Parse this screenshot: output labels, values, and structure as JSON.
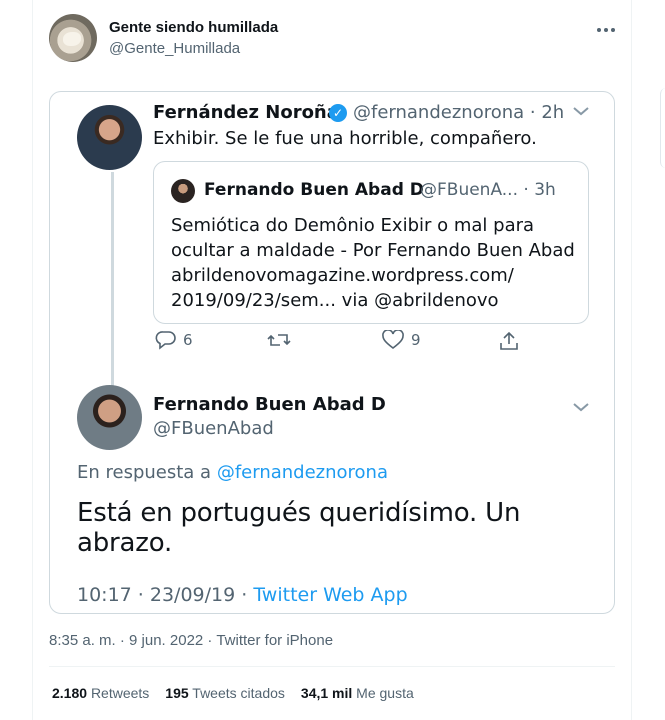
{
  "header": {
    "display_name": "Gente siendo humillada",
    "handle": "@Gente_Humillada",
    "more_icon": "more-horizontal-icon"
  },
  "embedded": {
    "first_tweet": {
      "name": "Fernández Noroña",
      "handle_time": "@fernandeznorona · 2h",
      "text": "Exhibir. Se le fue una horrible, compañero."
    },
    "quoted": {
      "name": "Fernando Buen Abad D",
      "handle_time": "@FBuenA... · 3h",
      "lines": [
        "Semiótica do Demônio Exibir o mal para",
        "ocultar a maldade - Por Fernando Buen Abad",
        "abrildenovomagazine.wordpress.com/",
        "2019/09/23/sem... via @abrildenovo"
      ]
    },
    "actions": {
      "replies": "6",
      "likes": "9"
    },
    "second_tweet": {
      "name": "Fernando Buen Abad D",
      "handle": "@FBuenAbad",
      "reply_prefix": "En respuesta a",
      "reply_mention": "@fernandeznorona",
      "text": "Está en portugués queridísimo. Un abrazo.",
      "time_date": "10:17 · 23/09/19 ·",
      "source": "Twitter Web App"
    }
  },
  "meta": {
    "timestamp": "8:35 a. m. · 9 jun. 2022 · Twitter for iPhone"
  },
  "stats": {
    "retweets_count": "2.180",
    "retweets_label": "Retweets",
    "quotes_count": "195",
    "quotes_label": "Tweets citados",
    "likes_count": "34,1 mil",
    "likes_label": "Me gusta"
  },
  "colors": {
    "accent": "#1d9bf0",
    "muted": "#536471",
    "text": "#0f1419",
    "border": "#cfd9de"
  }
}
